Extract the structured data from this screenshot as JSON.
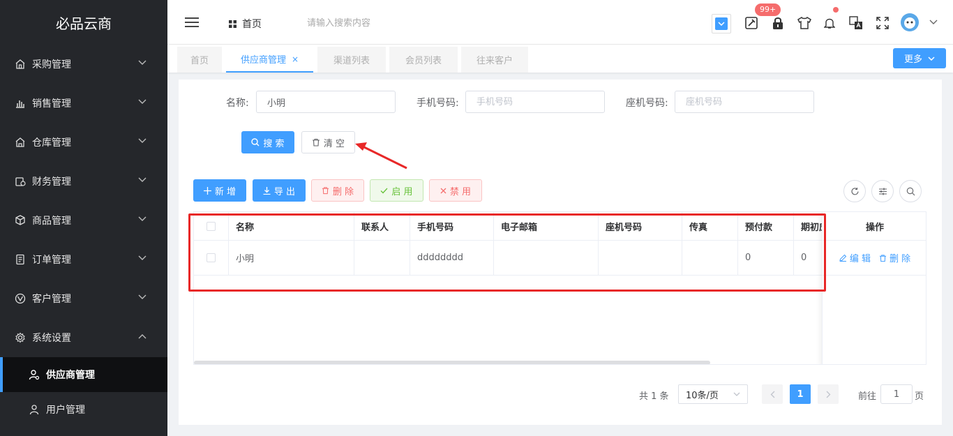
{
  "app": {
    "logo": "必品云商"
  },
  "sidebar": {
    "items": [
      {
        "label": "采购管理",
        "icon": "store-icon"
      },
      {
        "label": "销售管理",
        "icon": "bar-chart-icon"
      },
      {
        "label": "仓库管理",
        "icon": "warehouse-icon"
      },
      {
        "label": "财务管理",
        "icon": "money-icon"
      },
      {
        "label": "商品管理",
        "icon": "box-icon"
      },
      {
        "label": "订单管理",
        "icon": "document-icon"
      },
      {
        "label": "客户管理",
        "icon": "vue-icon"
      },
      {
        "label": "系统设置",
        "icon": "gear-icon"
      }
    ],
    "subitems": [
      {
        "label": "供应商管理"
      },
      {
        "label": "用户管理"
      }
    ]
  },
  "header": {
    "breadcrumb": "首页",
    "search_placeholder": "请输入搜索内容",
    "badge": "99+"
  },
  "tabs": [
    {
      "label": "首页"
    },
    {
      "label": "供应商管理",
      "close": "×"
    },
    {
      "label": "渠道列表"
    },
    {
      "label": "会员列表"
    },
    {
      "label": "往来客户"
    }
  ],
  "more_label": "更多",
  "filters": {
    "name_label": "名称:",
    "name_value": "小明",
    "mobile_label": "手机号码:",
    "mobile_placeholder": "手机号码",
    "phone_label": "座机号码:",
    "phone_placeholder": "座机号码"
  },
  "search_btn": "搜 索",
  "clear_btn": "清 空",
  "toolbar": {
    "add": "新 增",
    "export": "导 出",
    "delete": "删 除",
    "enable": "启 用",
    "disable": "禁 用"
  },
  "table": {
    "headers": [
      "名称",
      "联系人",
      "手机号码",
      "电子邮箱",
      "座机号码",
      "传真",
      "预付款",
      "期初应"
    ],
    "action_header": "操作",
    "rows": [
      {
        "name": "小明",
        "contact": "",
        "mobile": "dddddddd",
        "email": "",
        "phone": "",
        "fax": "",
        "prepay": "0",
        "opening": "0"
      }
    ],
    "edit": "编 辑",
    "remove": "删 除"
  },
  "pagination": {
    "total": "共 1 条",
    "page_size": "10条/页",
    "current": "1",
    "goto_label": "前往",
    "goto_value": "1",
    "page_suffix": "页"
  },
  "colors": {
    "primary": "#409eff",
    "sidebar": "#25272b",
    "annotation": "#e82828"
  }
}
